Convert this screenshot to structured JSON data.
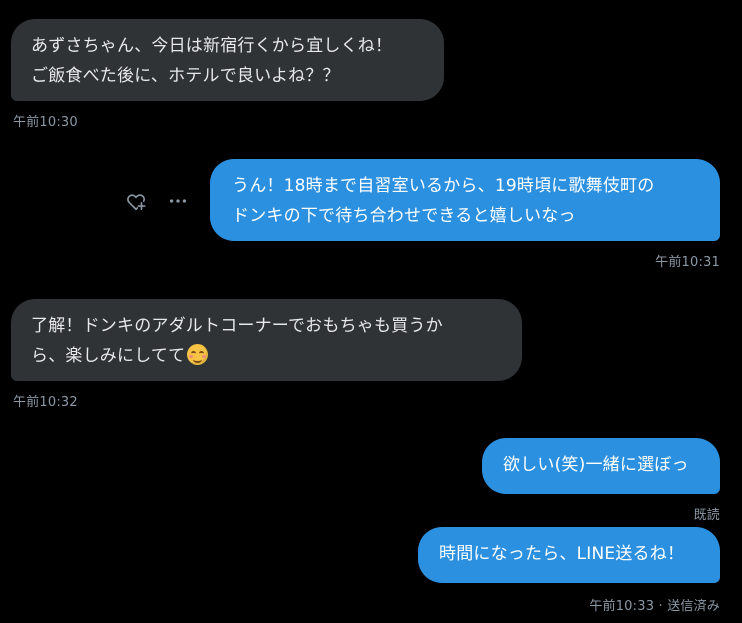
{
  "messages": [
    {
      "direction": "in",
      "lines": [
        "あずさちゃん、今日は新宿行くから宜しくね！",
        "ご飯食べた後に、ホテルで良いよね？？"
      ],
      "time": "午前10:30"
    },
    {
      "direction": "out",
      "lines": [
        "うん！18時まで自習室いるから、19時頃に歌舞伎町の",
        "ドンキの下で待ち合わせできると嬉しいなっ"
      ],
      "time": "午前10:31"
    },
    {
      "direction": "in",
      "lines": [
        "了解！ドンキのアダルトコーナーでおもちゃも買うか",
        "ら、楽しみにしてて"
      ],
      "emoji": "smiling-face-with-smiling-eyes",
      "time": "午前10:32"
    },
    {
      "direction": "out",
      "lines": [
        "欲しい(笑)一緒に選ぼっ"
      ],
      "status": "既読"
    },
    {
      "direction": "out",
      "lines": [
        "時間になったら、LINE送るね！"
      ],
      "time": "午前10:33",
      "status": "送信済み"
    }
  ],
  "actions": {
    "react_icon": "heart-plus-icon",
    "more_icon": "more-horizontal-icon"
  },
  "colors": {
    "background": "#000000",
    "incoming_bubble": "#2f3336",
    "outgoing_bubble": "#2c90e0",
    "timestamp": "#8b98a5"
  },
  "separator": " · "
}
